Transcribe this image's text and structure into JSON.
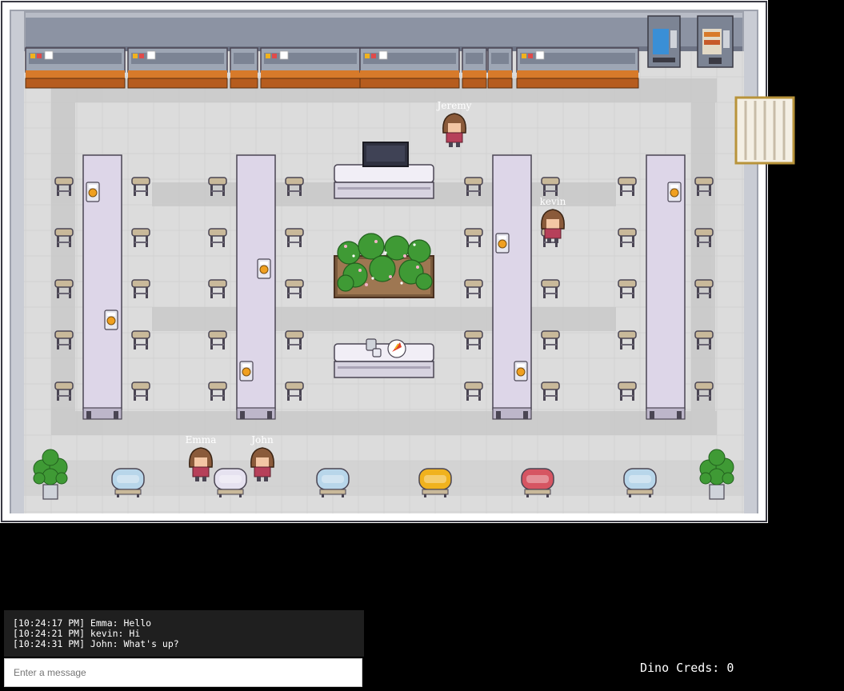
{
  "players": [
    {
      "name": "Jeremy"
    },
    {
      "name": "kevin"
    },
    {
      "name": "Emma"
    },
    {
      "name": "John"
    }
  ],
  "chat": {
    "messages": [
      "[10:24:17 PM] Emma: Hello",
      "[10:24:21 PM] kevin: Hi",
      "[10:24:31 PM] John: What's up?"
    ],
    "placeholder": "Enter a message"
  },
  "hud": {
    "dino_creds": "Dino Creds: 0"
  },
  "colors": {
    "chair_blue": "#b8d6ea",
    "chair_lavender": "#e6e2f0",
    "chair_yellow": "#f0b21e",
    "chair_red": "#d65562",
    "table_top": "#ddd6e8",
    "plant_green": "#3f9a35",
    "hair_brown": "#8a5a3a"
  }
}
